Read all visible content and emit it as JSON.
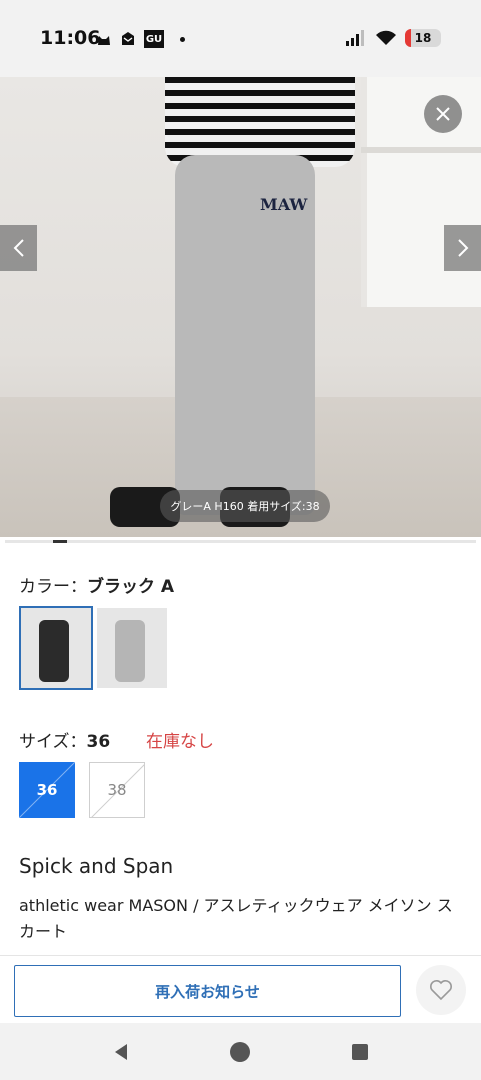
{
  "status_bar": {
    "time": "11:06",
    "gu_label": "GU",
    "battery_level": "18",
    "battery_fraction": 0.18,
    "icons_left": [
      "cat-icon",
      "mail-icon",
      "gu-icon"
    ],
    "icons_right": [
      "signal-icon",
      "wifi-icon",
      "battery-icon"
    ]
  },
  "product_image": {
    "caption": "グレーA H160 着用サイズ:38",
    "logo_text": "MAW"
  },
  "color": {
    "label": "カラー：",
    "selected_value": "ブラック A",
    "swatches": [
      {
        "color": "#2b2b2b"
      },
      {
        "color": "#b5b5b5"
      }
    ]
  },
  "size": {
    "label": "サイズ：",
    "selected_value": "36",
    "stock_status": "在庫なし",
    "options": [
      "36",
      "38"
    ]
  },
  "product": {
    "brand": "Spick and Span",
    "name": "athletic wear MASON / アスレティックウェア メイソン スカート"
  },
  "actions": {
    "restock_label": "再入荷お知らせ"
  },
  "colors": {
    "accent": "#1a73e8",
    "button_border": "#2f6fb6",
    "out_of_stock": "#d64545"
  }
}
